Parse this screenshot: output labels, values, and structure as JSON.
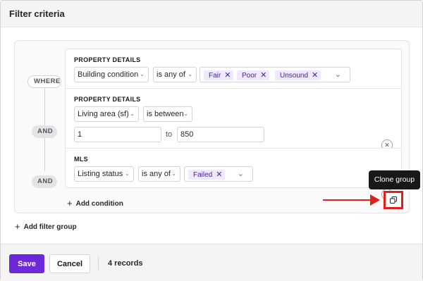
{
  "modal": {
    "title": "Filter criteria"
  },
  "connectors": {
    "where": "WHERE",
    "and1": "AND",
    "and2": "AND"
  },
  "conditions": [
    {
      "section": "PROPERTY DETAILS",
      "field": "Building condition",
      "operator": "is any of",
      "tags": [
        "Fair",
        "Poor",
        "Unsound"
      ]
    },
    {
      "section": "PROPERTY DETAILS",
      "field": "Living area (sf)",
      "operator": "is between",
      "min": "1",
      "to_label": "to",
      "max": "850"
    },
    {
      "section": "MLS",
      "field": "Listing status",
      "operator": "is any of",
      "tags": [
        "Failed"
      ]
    }
  ],
  "actions": {
    "add_condition": "Add condition",
    "add_filter_group": "Add filter group",
    "clone_group_tooltip": "Clone group"
  },
  "footer": {
    "save": "Save",
    "cancel": "Cancel",
    "records": "4 records"
  },
  "colors": {
    "accent": "#6d28d9",
    "tag_bg": "#ede9fe",
    "highlight": "#e0201a"
  },
  "icons": [
    "close-icon",
    "chevron-down-icon",
    "plus-icon",
    "copy-icon"
  ]
}
